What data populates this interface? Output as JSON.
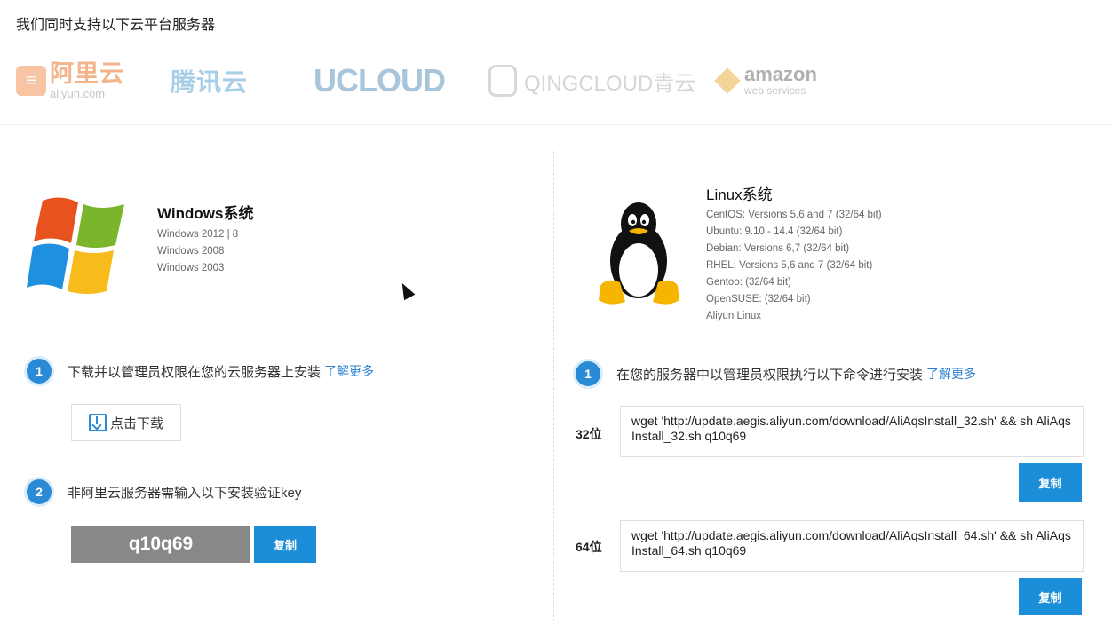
{
  "header": {
    "text": "我们同时支持以下云平台服务器"
  },
  "logos": {
    "aliyun": {
      "main": "阿里云",
      "sub": "aliyun.com"
    },
    "tencent": "腾讯云",
    "ucloud": "UCLOUD",
    "qingcloud": "QINGCLOUD青云",
    "amazon": {
      "main": "amazon",
      "sub": "web services"
    }
  },
  "windows": {
    "title": "Windows系统",
    "versions": [
      "Windows 2012 | 8",
      "Windows 2008",
      "Windows 2003"
    ],
    "step1": {
      "num": "1",
      "text": "下载并以管理员权限在您的云服务器上安装",
      "link": "了解更多"
    },
    "download_label": "点击下载",
    "step2": {
      "num": "2",
      "text": "非阿里云服务器需输入以下安装验证key"
    },
    "key": "q10q69",
    "copy_label": "复制"
  },
  "linux": {
    "title": "Linux系统",
    "versions": [
      "CentOS: Versions 5,6 and 7 (32/64 bit)",
      "Ubuntu: 9.10 - 14.4 (32/64 bit)",
      "Debian: Versions 6,7 (32/64 bit)",
      "RHEL: Versions 5,6 and 7 (32/64 bit)",
      "Gentoo: (32/64 bit)",
      "OpenSUSE: (32/64 bit)",
      "Aliyun Linux"
    ],
    "step1": {
      "num": "1",
      "text": "在您的服务器中以管理员权限执行以下命令进行安装",
      "link": "了解更多"
    },
    "bits32": {
      "label": "32位",
      "cmd": "wget 'http://update.aegis.aliyun.com/download/AliAqsInstall_32.sh' && sh AliAqsInstall_32.sh q10q69",
      "copy": "复制"
    },
    "bits64": {
      "label": "64位",
      "cmd": "wget 'http://update.aegis.aliyun.com/download/AliAqsInstall_64.sh' && sh AliAqsInstall_64.sh q10q69",
      "copy": "复制"
    }
  }
}
